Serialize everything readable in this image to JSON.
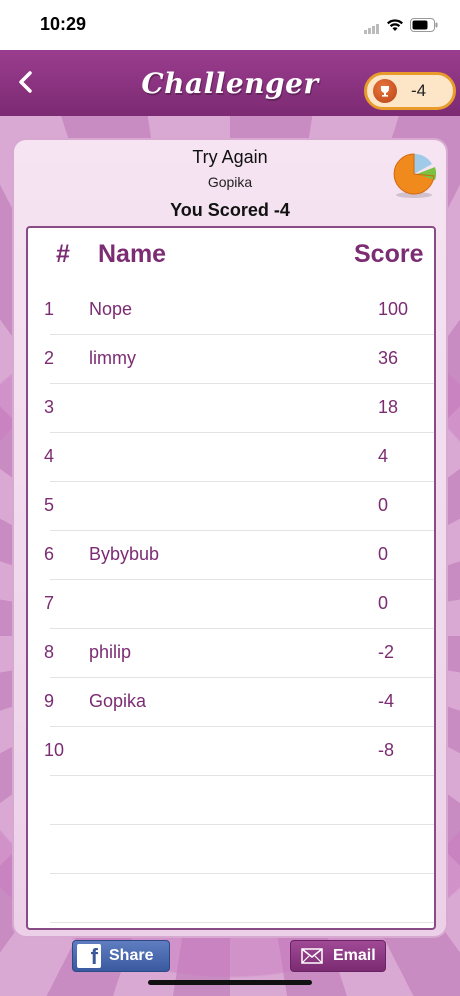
{
  "status_bar": {
    "time": "10:29"
  },
  "nav": {
    "brand": "Challenger",
    "score_badge": "-4"
  },
  "result": {
    "title": "Try Again",
    "player": "Gopika",
    "scored": "You Scored -4"
  },
  "leaderboard": {
    "headers": {
      "rank": "#",
      "name": "Name",
      "score": "Score"
    },
    "rows": [
      {
        "rank": "1",
        "name": "Nope",
        "score": "100"
      },
      {
        "rank": "2",
        "name": "limmy",
        "score": "36"
      },
      {
        "rank": "3",
        "name": "",
        "score": "18"
      },
      {
        "rank": "4",
        "name": "",
        "score": "4"
      },
      {
        "rank": "5",
        "name": "",
        "score": "0"
      },
      {
        "rank": "6",
        "name": "Bybybub",
        "score": "0"
      },
      {
        "rank": "7",
        "name": "",
        "score": "0"
      },
      {
        "rank": "8",
        "name": "philip",
        "score": "-2"
      },
      {
        "rank": "9",
        "name": "Gopika",
        "score": "-4"
      },
      {
        "rank": "10",
        "name": "",
        "score": "-8"
      }
    ]
  },
  "buttons": {
    "share": "Share",
    "email": "Email"
  },
  "icons": {
    "back": "chevron-left-icon",
    "trophy": "trophy-icon",
    "stats": "pie-chart-icon",
    "facebook": "facebook-icon",
    "email": "envelope-icon"
  },
  "colors": {
    "brand_purple": "#7b2c72",
    "badge_border": "#e89a2a",
    "facebook_blue": "#3a5aa0"
  }
}
